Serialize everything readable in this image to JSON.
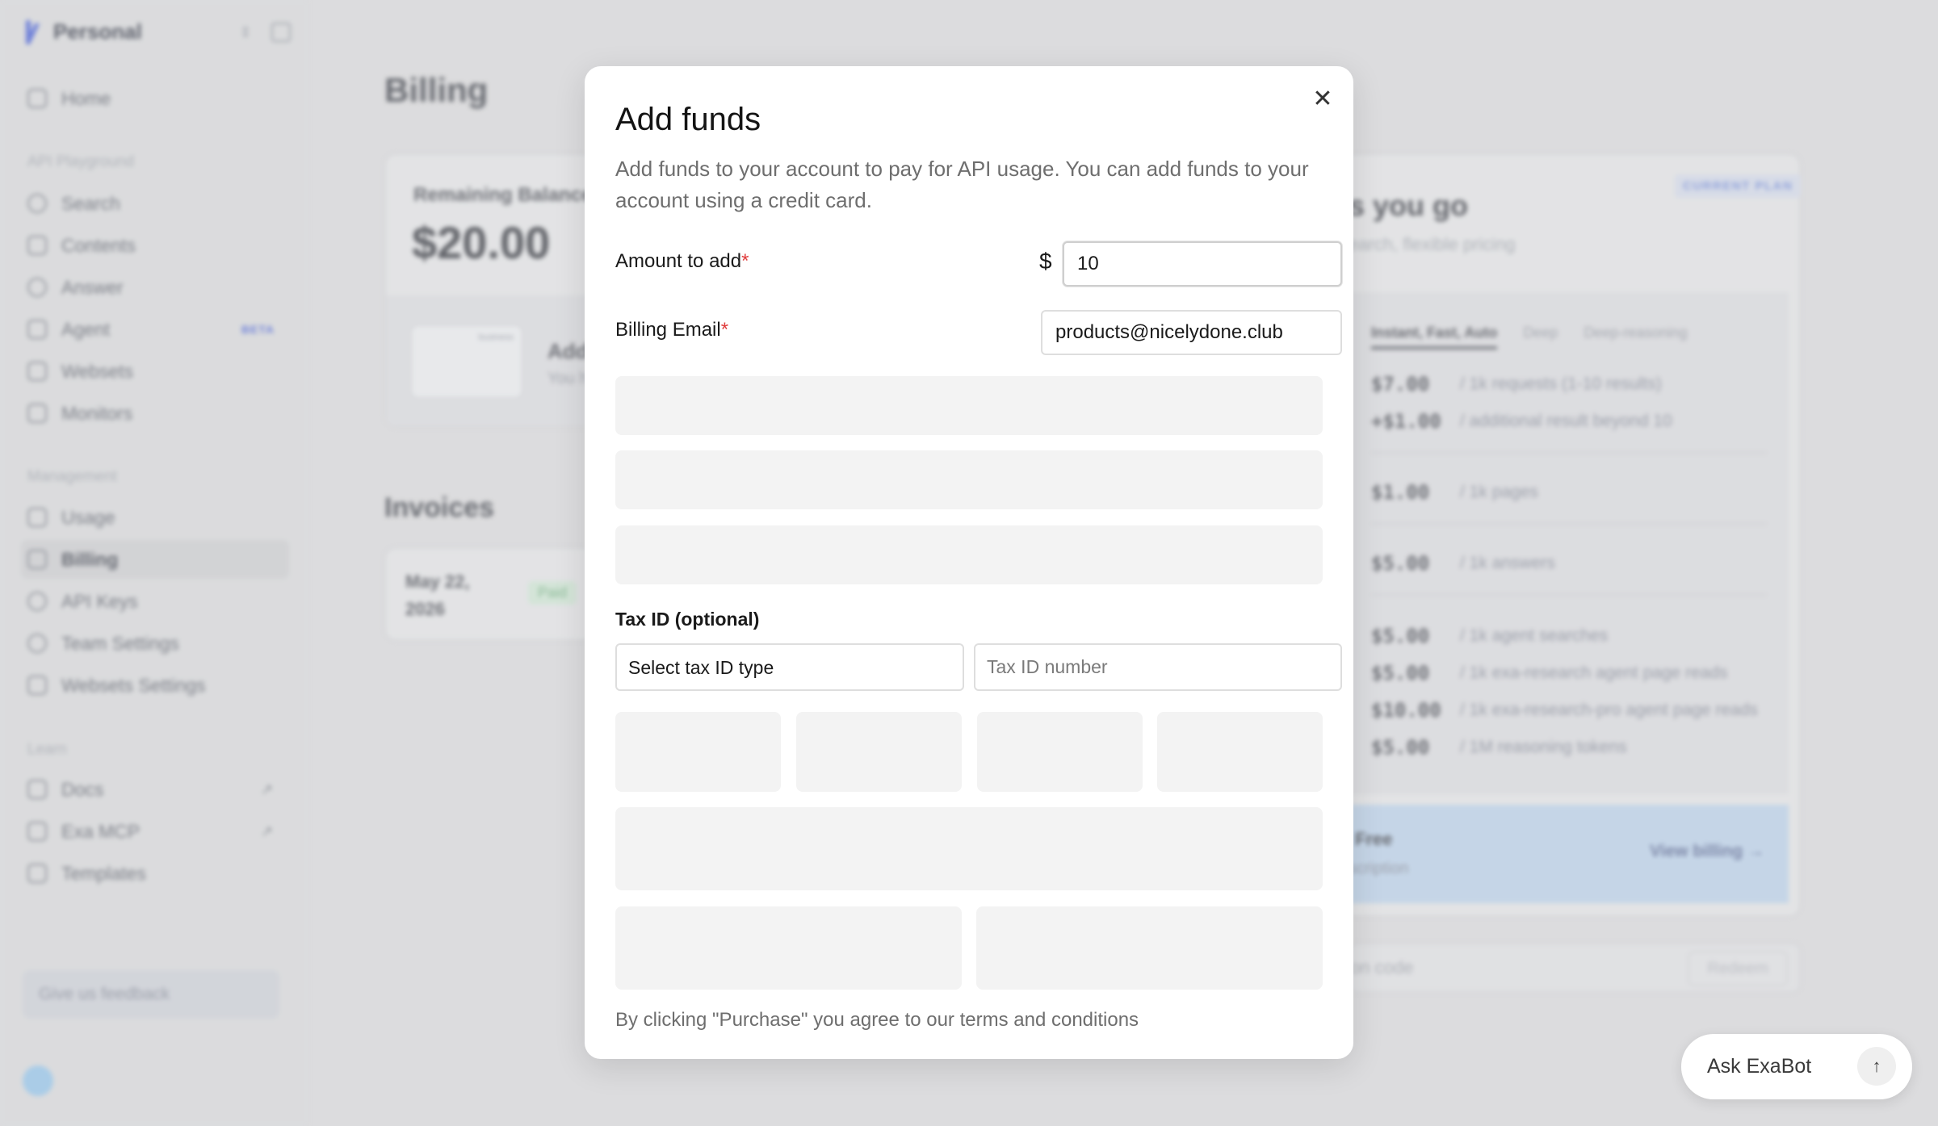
{
  "sidebar": {
    "workspace": "Personal",
    "items_top": [
      {
        "label": "Home"
      }
    ],
    "sections": [
      {
        "title": "API Playground",
        "items": [
          {
            "label": "Search"
          },
          {
            "label": "Contents"
          },
          {
            "label": "Answer"
          },
          {
            "label": "Agent",
            "badge": "BETA"
          },
          {
            "label": "Websets"
          },
          {
            "label": "Monitors"
          }
        ]
      },
      {
        "title": "Management",
        "items": [
          {
            "label": "Usage"
          },
          {
            "label": "Billing"
          },
          {
            "label": "API Keys"
          },
          {
            "label": "Team Settings"
          },
          {
            "label": "Websets Settings"
          }
        ]
      },
      {
        "title": "Learn",
        "items": [
          {
            "label": "Docs"
          },
          {
            "label": "Exa MCP"
          },
          {
            "label": "Templates"
          }
        ]
      }
    ],
    "feedback": "Give us feedback"
  },
  "billing": {
    "title": "Billing",
    "balance_label": "Remaining Balance",
    "balance": "$20.00",
    "add_label": "Add",
    "add_sub": "You h",
    "mini_card_label": "business",
    "invoices_title": "Invoices",
    "invoice": {
      "date_line1": "May 22,",
      "date_line2": "2026",
      "status": "Paid"
    }
  },
  "plan": {
    "title": "s you go",
    "subtitle": "earch, flexible pricing",
    "badge": "CURRENT PLAN",
    "tabs": [
      "Instant, Fast, Auto",
      "Deep",
      "Deep-reasoning"
    ],
    "rows": [
      {
        "price": "$7.00",
        "desc": "/ 1k requests (1-10 results)"
      },
      {
        "price": "+$1.00",
        "desc": "/ additional result beyond 10"
      },
      {
        "price": "$1.00",
        "desc": "/ 1k pages"
      },
      {
        "price": "$5.00",
        "desc": "/ 1k answers"
      },
      {
        "price": "$5.00",
        "desc": "/ 1k agent searches"
      },
      {
        "price": "$5.00",
        "desc": "/ 1k exa-research agent page reads"
      },
      {
        "price": "$10.00",
        "desc": "/ 1k exa-research-pro agent page reads"
      },
      {
        "price": "$5.00",
        "desc": "/ 1M reasoning tokens"
      }
    ],
    "free_title": "Free",
    "free_sub": "scription",
    "view_billing": "View billing →",
    "promo_placeholder": "on code",
    "redeem": "Redeem"
  },
  "modal": {
    "title": "Add funds",
    "description": "Add funds to your account to pay for API usage. You can add funds to your account using a credit card.",
    "amount_label": "Amount to add",
    "required_mark": "*",
    "currency": "$",
    "amount_value": "10",
    "email_label": "Billing Email",
    "email_value": "products@nicelydone.club",
    "tax_label": "Tax ID (optional)",
    "tax_type_value": "Select tax ID type",
    "tax_number_placeholder": "Tax ID number",
    "terms": "By clicking \"Purchase\" you agree to our terms and conditions"
  },
  "exabot": {
    "label": "Ask ExaBot"
  },
  "colors": {
    "accent": "#3a55d6",
    "required": "#e03c3c",
    "skeleton": "#f3f3f3"
  }
}
